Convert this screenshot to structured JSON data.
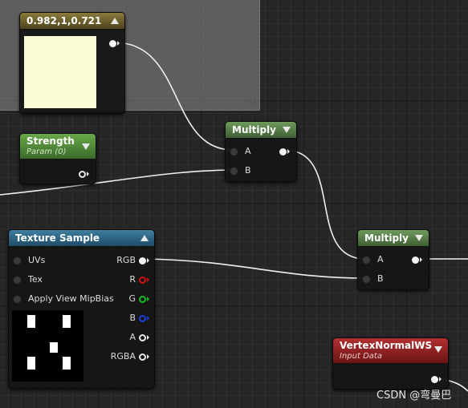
{
  "nodes": {
    "constant": {
      "title": "0.982,1,0.721",
      "swatch_color": "#FBFBD8"
    },
    "strength": {
      "title": "Strength",
      "subtitle": "Param (0)"
    },
    "multiply1": {
      "title": "Multiply",
      "pin_a": "A",
      "pin_b": "B"
    },
    "multiply2": {
      "title": "Multiply",
      "pin_a": "A",
      "pin_b": "B"
    },
    "texture_sample": {
      "title": "Texture Sample",
      "inputs": [
        "UVs",
        "Tex",
        "Apply View MipBias"
      ],
      "outputs": [
        "RGB",
        "R",
        "G",
        "B",
        "A",
        "RGBA"
      ],
      "output_colors": [
        "#f2f2f2",
        "#d01010",
        "#10c020",
        "#2040e0",
        "#e8e8e8",
        "#e8e8e8"
      ]
    },
    "vertex_normal": {
      "title": "VertexNormalWS",
      "subtitle": "Input Data"
    }
  },
  "watermark": "CSDN @弯曼巴",
  "icons": [
    "collapse-arrow-up-icon",
    "collapse-arrow-down-icon",
    "resize-grip-icon"
  ]
}
